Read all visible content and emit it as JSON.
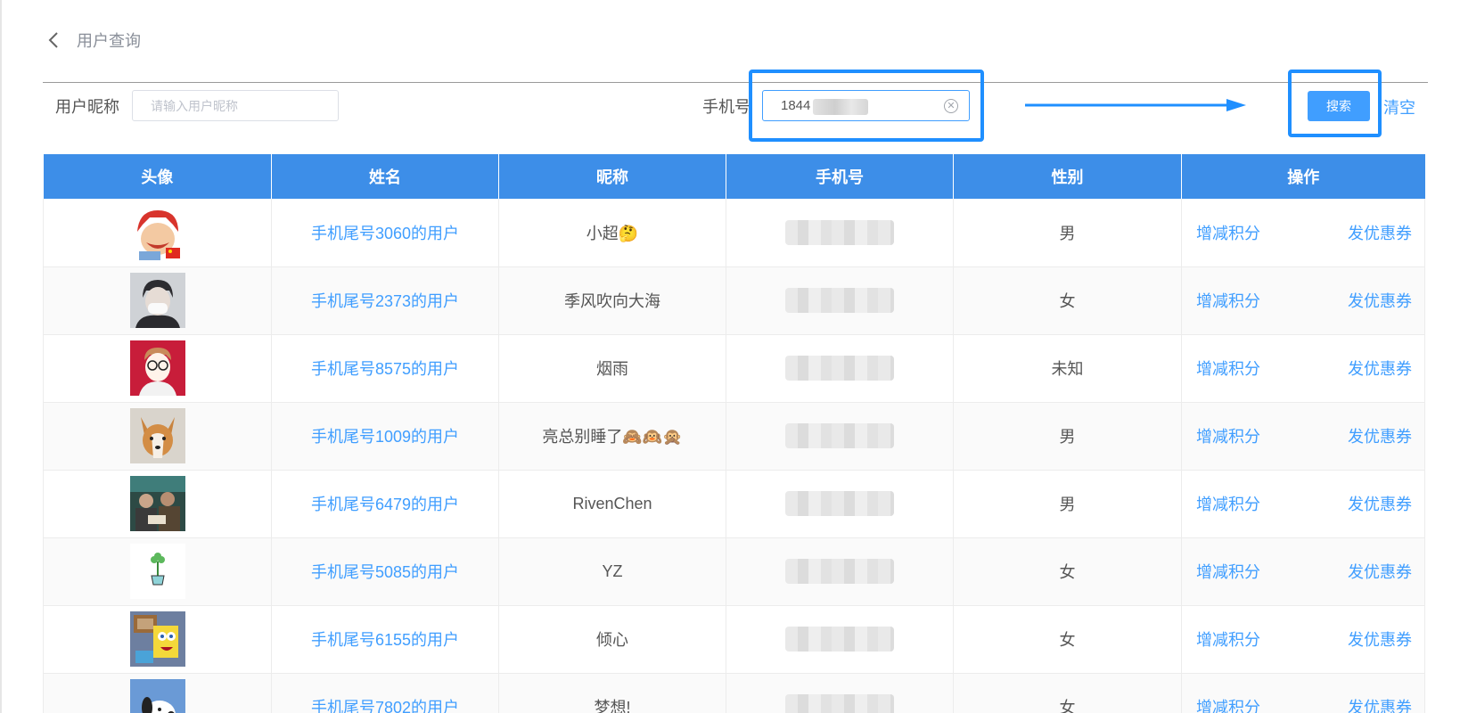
{
  "header": {
    "title": "用户查询"
  },
  "filters": {
    "nickname_label": "用户昵称",
    "nickname_placeholder": "请输入用户昵称",
    "phone_label": "手机号",
    "phone_value": "1844",
    "search_label": "搜索",
    "clear_label": "清空"
  },
  "table": {
    "columns": [
      "头像",
      "姓名",
      "昵称",
      "手机号",
      "性别",
      "操作"
    ],
    "action_points": "增减积分",
    "action_coupon": "发优惠券",
    "rows": [
      {
        "name": "手机尾号3060的用户",
        "nickname": "小超🤔",
        "gender": "男",
        "avatar": "cartoon-red-hair-avatar"
      },
      {
        "name": "手机尾号2373的用户",
        "nickname": "季风吹向大海",
        "gender": "女",
        "avatar": "masked-person-avatar"
      },
      {
        "name": "手机尾号8575的用户",
        "nickname": "烟雨",
        "gender": "未知",
        "avatar": "cartoon-glasses-avatar"
      },
      {
        "name": "手机尾号1009的用户",
        "nickname": "亮总别睡了🙈🙉🙊",
        "gender": "男",
        "avatar": "corgi-dog-avatar"
      },
      {
        "name": "手机尾号6479的用户",
        "nickname": "RivenChen",
        "gender": "男",
        "avatar": "group-photo-avatar"
      },
      {
        "name": "手机尾号5085的用户",
        "nickname": "YZ",
        "gender": "女",
        "avatar": "potted-plant-avatar"
      },
      {
        "name": "手机尾号6155的用户",
        "nickname": "倾心",
        "gender": "女",
        "avatar": "cartoon-sponge-avatar"
      },
      {
        "name": "手机尾号7802的用户",
        "nickname": "梦想!",
        "gender": "女",
        "avatar": "snoopy-dog-avatar"
      }
    ]
  },
  "colors": {
    "accent": "#409eff",
    "header_bg": "#3d8ee8",
    "highlight": "#1f8fff"
  }
}
